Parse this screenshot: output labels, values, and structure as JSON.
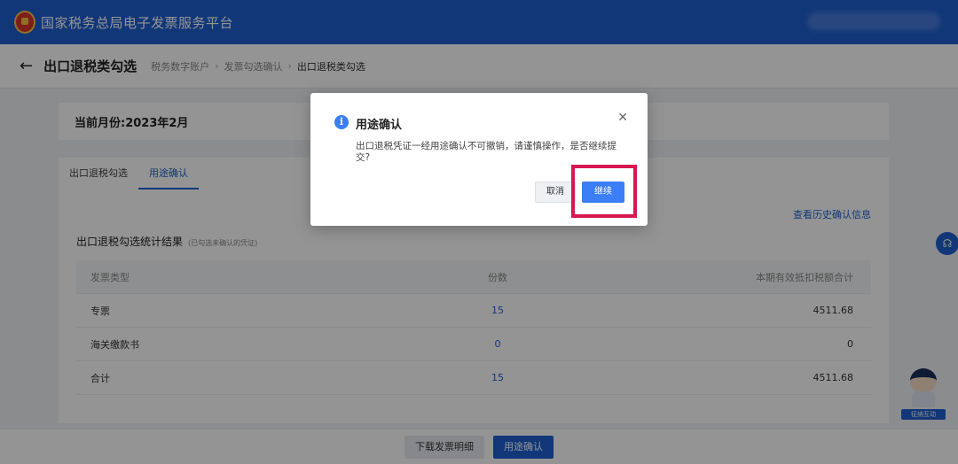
{
  "app": {
    "title": "国家税务总局电子发票服务平台"
  },
  "page": {
    "title": "出口退税类勾选",
    "breadcrumbs": [
      "税务数字账户",
      "发票勾选确认",
      "出口退税类勾选"
    ]
  },
  "month": {
    "label": "当前月份:2023年2月"
  },
  "tabs": [
    "出口退税勾选",
    "用途确认"
  ],
  "history_link": "查看历史确认信息",
  "stats": {
    "title": "出口退税勾选统计结果",
    "subtitle": "(已勾选未确认的凭证)",
    "columns": [
      "发票类型",
      "份数",
      "本期有效抵扣税额合计"
    ],
    "rows": [
      {
        "type": "专票",
        "count": "15",
        "tax": "4511.68"
      },
      {
        "type": "海关缴款书",
        "count": "0",
        "tax": "0"
      },
      {
        "type": "合计",
        "count": "15",
        "tax": "4511.68"
      }
    ]
  },
  "bottom": {
    "download_label": "下载发票明细",
    "confirm_label": "用途确认"
  },
  "mascot": {
    "label": "征纳互动"
  },
  "dialog": {
    "title": "用途确认",
    "message": "出口退税凭证一经用途确认不可撤销，请谨慎操作，是否继续提交?",
    "cancel_label": "取消",
    "continue_label": "继续"
  },
  "colors": {
    "primary": "#1f5fd1",
    "highlight": "#d8164f"
  },
  "icons": {
    "back": "back-arrow-icon",
    "close": "close-icon",
    "info": "info-icon",
    "help": "headset-icon"
  }
}
